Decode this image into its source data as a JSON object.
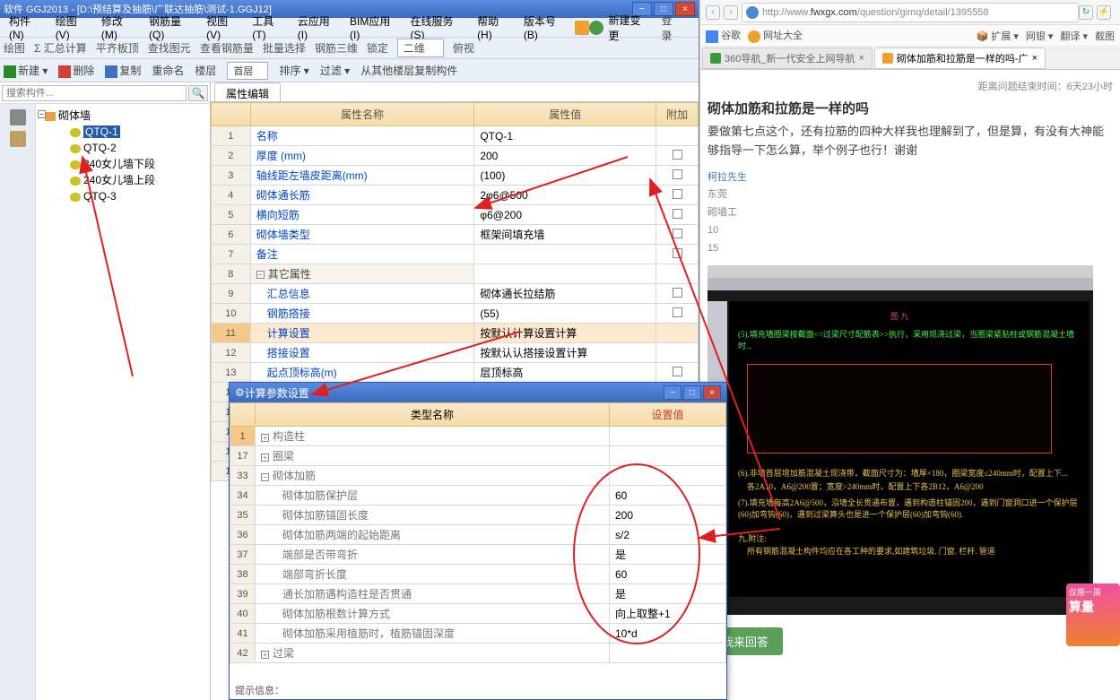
{
  "app": {
    "title": "软件 GGJ2013 - [D:\\预结算及抽筋\\广联达抽筋\\测试-1.GGJ12]",
    "menus": [
      "构件(N)",
      "绘图(V)",
      "修改(M)",
      "钢筋量(Q)",
      "视图(V)",
      "工具(T)",
      "云应用(I)",
      "BIM应用(I)",
      "在线服务(S)",
      "帮助(H)",
      "版本号(B)"
    ],
    "new_change": "新建变更",
    "login": "登录",
    "tb1": [
      "绘图",
      "Σ 汇总计算",
      "平齐板顶",
      "查找图元",
      "查看钢筋量",
      "批量选择",
      "钢筋三维",
      "锁定"
    ],
    "tb1_sel": "二维",
    "tb1_rot": "俯视",
    "tb2": {
      "new": "新建",
      "del": "删除",
      "copy": "复制",
      "rename": "重命名",
      "floor": "楼层",
      "floor_sel": "首层",
      "sort": "排序",
      "filter": "过滤",
      "copyfrom": "从其他楼层复制构件"
    }
  },
  "tree": {
    "search_ph": "搜索构件...",
    "root": "砌体墙",
    "items": [
      "QTQ-1",
      "QTQ-2",
      "240女儿墙下段",
      "240女儿墙上段",
      "QTQ-3"
    ]
  },
  "props": {
    "tab": "属性编辑",
    "headers": {
      "name": "属性名称",
      "value": "属性值",
      "extra": "附加"
    },
    "rows": [
      {
        "n": "1",
        "name": "名称",
        "val": "QTQ-1",
        "chk": false
      },
      {
        "n": "2",
        "name": "厚度 (mm)",
        "val": "200",
        "chk": true
      },
      {
        "n": "3",
        "name": "轴线距左墙皮距离(mm)",
        "val": "(100)",
        "chk": true
      },
      {
        "n": "4",
        "name": "砌体通长筋",
        "val": "2φ6@500",
        "chk": true
      },
      {
        "n": "5",
        "name": "横向短筋",
        "val": "φ6@200",
        "chk": true
      },
      {
        "n": "6",
        "name": "砌体墙类型",
        "val": "框架间填充墙",
        "chk": true
      },
      {
        "n": "7",
        "name": "备注",
        "val": "",
        "chk": true
      },
      {
        "n": "8",
        "name": "其它属性",
        "val": "",
        "grp": true
      },
      {
        "n": "9",
        "name": "汇总信息",
        "val": "砌体通长拉结筋",
        "chk": true,
        "indent": true
      },
      {
        "n": "10",
        "name": "钢筋搭接",
        "val": "(55)",
        "chk": true,
        "indent": true
      },
      {
        "n": "11",
        "name": "计算设置",
        "val": "按默认计算设置计算",
        "hl": true,
        "indent": true
      },
      {
        "n": "12",
        "name": "搭接设置",
        "val": "按默认认搭接设置计算",
        "indent": true
      },
      {
        "n": "13",
        "name": "起点顶标高(m)",
        "val": "层顶标高",
        "chk": true,
        "indent": true
      },
      {
        "n": "14",
        "name": "",
        "val": "",
        "indent": true
      },
      {
        "n": "15",
        "name": "",
        "val": "",
        "indent": true
      },
      {
        "n": "16",
        "name": "",
        "val": "",
        "indent": true
      },
      {
        "n": "17",
        "name": "",
        "val": "",
        "indent": true
      },
      {
        "n": "18",
        "name": "",
        "val": "",
        "indent": true
      }
    ]
  },
  "dialog": {
    "title": "计算参数设置",
    "headers": {
      "type": "类型名称",
      "val": "设置值"
    },
    "rows": [
      {
        "n": "1",
        "name": "构造柱",
        "grp": true,
        "exp": "+",
        "sel": true
      },
      {
        "n": "17",
        "name": "圈梁",
        "grp": true,
        "exp": "+"
      },
      {
        "n": "33",
        "name": "砌体加筋",
        "grp": true,
        "exp": "−"
      },
      {
        "n": "34",
        "name": "砌体加筋保护层",
        "val": "60",
        "indent": true
      },
      {
        "n": "35",
        "name": "砌体加筋锚固长度",
        "val": "200",
        "indent": true
      },
      {
        "n": "36",
        "name": "砌体加筋两端的起始距离",
        "val": "s/2",
        "indent": true
      },
      {
        "n": "37",
        "name": "端部是否带弯折",
        "val": "是",
        "indent": true
      },
      {
        "n": "38",
        "name": "端部弯折长度",
        "val": "60",
        "indent": true
      },
      {
        "n": "39",
        "name": "通长加筋遇构造柱是否贯通",
        "val": "是",
        "indent": true
      },
      {
        "n": "40",
        "name": "砌体加筋根数计算方式",
        "val": "向上取整+1",
        "indent": true
      },
      {
        "n": "41",
        "name": "砌体加筋采用植筋时，植筋锚固深度",
        "val": "10*d",
        "indent": true
      },
      {
        "n": "42",
        "name": "过梁",
        "grp": true,
        "exp": "+"
      }
    ],
    "footer": "提示信息："
  },
  "browser": {
    "url_prefix": "http://www.",
    "url_host": "fwxgx.com",
    "url_path": "/question/gimq/detail/1395558",
    "bookmarks": {
      "g": "谷歌",
      "wz": "网址大全"
    },
    "tools": [
      "扩展",
      "网银",
      "翻译",
      "截图"
    ],
    "tabs": [
      {
        "label": "360导航_新一代安全上网导航",
        "active": false
      },
      {
        "label": "砌体加筋和拉筋是一样的吗-广",
        "active": true
      }
    ],
    "page": {
      "title": "砌体加筋和拉筋是一样的吗",
      "meta": "距离问题结束时间：6天23小时",
      "body": "要做第七点这个，还有拉筋的四种大样我也理解到了，但是算，有没有大神能够指导一下怎么算，举个例子也行！谢谢",
      "user": "柯拉先生",
      "loc": "东莞",
      "job": "砌墙工",
      "nums": [
        "10",
        "15"
      ],
      "reply": "我来回答"
    },
    "cad": {
      "title": "图 九",
      "note5": "(5).填充墙圈梁按截面<<过梁尺寸配筋表>>执行，采用现浇过梁，当圈梁紧贴柱或钢筋混凝土墙时...",
      "note6": "(6).非墙首层增加筋混凝土现浇带，截面尺寸为：墙厚×180，圈梁宽度≤240mm时，配置上下...",
      "note6b": "各2A10，A6@200置；宽度>240mm时，配置上下各2B12，A6@200",
      "note7": "(7).填充墙每高2A6@500，沿墙全长贯通布置，遇到构造柱锚固200，遇到门窗洞口进一个保护层(60)加弯钩(60)，遇到过梁算头也是进一个保护层(60)加弯钩(60).",
      "note9": "九.附注:",
      "note9b": "所有钢筋混凝土构件均应在各工种的要求,如建筑垃圾. 门窗. 栏杆. 管道"
    }
  },
  "ad": {
    "l1": "仅限一周",
    "l2": "算量"
  }
}
